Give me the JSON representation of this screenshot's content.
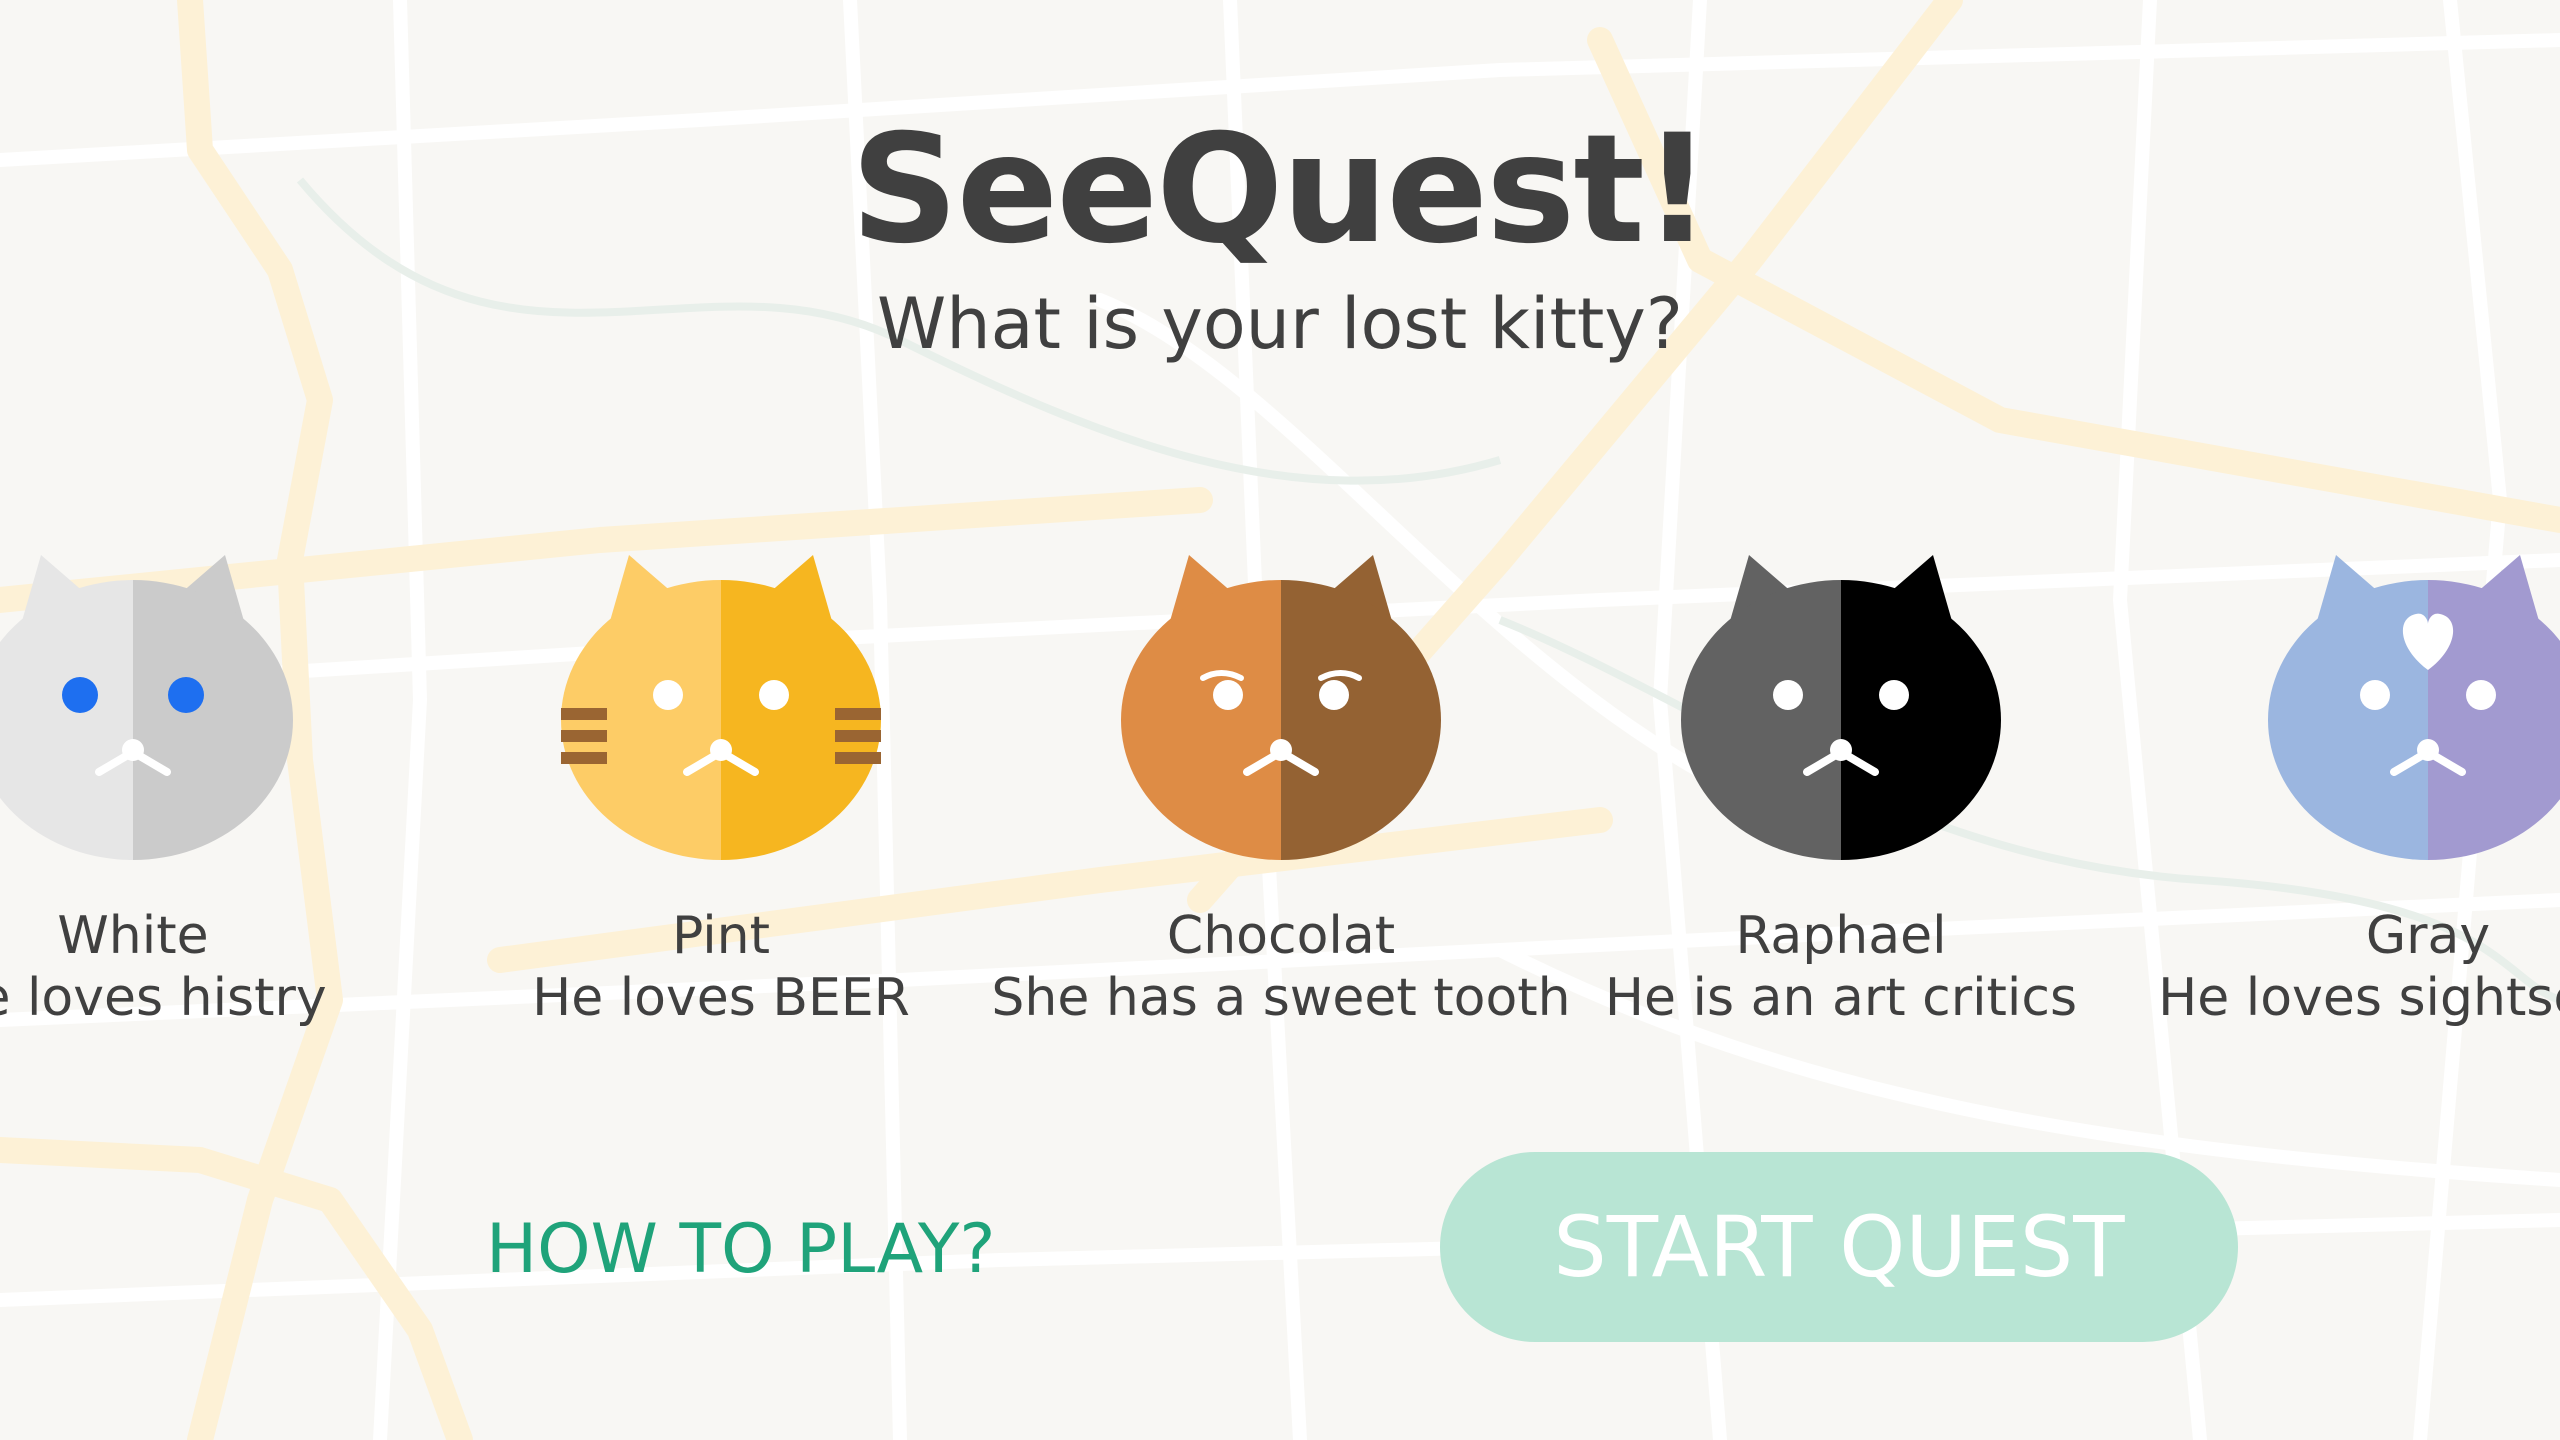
{
  "title": "SeeQuest!",
  "subtitle": "What is your lost kitty?",
  "cats": [
    {
      "name": "White",
      "desc": "He loves histry",
      "left_color": "#e6e6e6",
      "right_color": "#cbcbcb",
      "eye_color": "#1e6ff0",
      "feature": "blue-eyes"
    },
    {
      "name": "Pint",
      "desc": "He loves BEER",
      "left_color": "#fdcc66",
      "right_color": "#f6b620",
      "eye_color": "#ffffff",
      "feature": "whisker-stripes"
    },
    {
      "name": "Chocolat",
      "desc": "She has a sweet tooth",
      "left_color": "#de8c45",
      "right_color": "#946233",
      "eye_color": "#ffffff",
      "feature": "eyelashes"
    },
    {
      "name": "Raphael",
      "desc": "He is an art critics",
      "left_color": "#626262",
      "right_color": "#000000",
      "eye_color": "#ffffff",
      "feature": "plain"
    },
    {
      "name": "Gray",
      "desc": "He loves sightseeing",
      "left_color": "#9bb6e0",
      "right_color": "#a29ad0",
      "eye_color": "#ffffff",
      "feature": "heart-forehead"
    }
  ],
  "how_to_play": "HOW TO PLAY?",
  "start_quest": "START QUEST",
  "colors": {
    "background": "#f8f7f4",
    "text": "#404040",
    "accent": "#1fa37a",
    "button": "#b8e5d4",
    "map_road": "#fdf3dc"
  }
}
